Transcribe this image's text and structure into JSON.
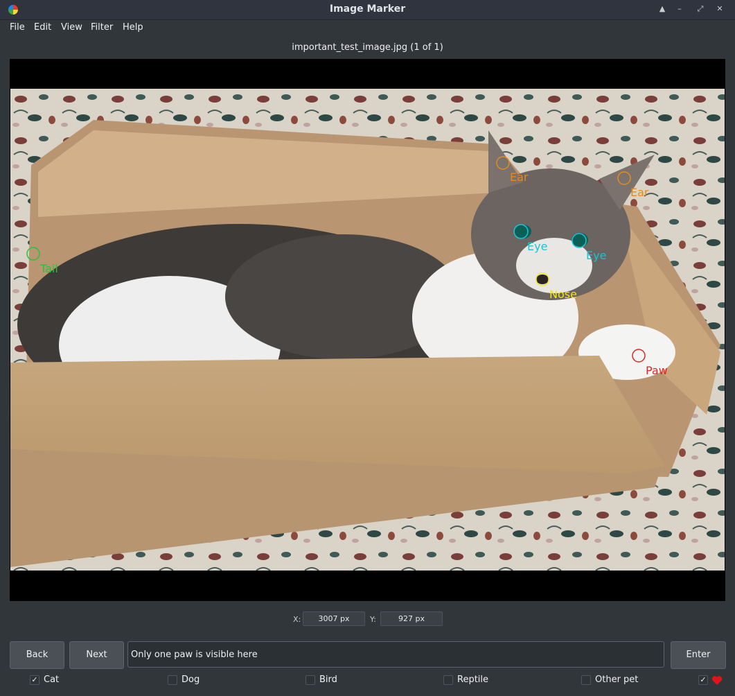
{
  "window": {
    "title": "Image Marker",
    "buttons": [
      "keep-above",
      "minimize",
      "restore",
      "close"
    ]
  },
  "menu": {
    "file": "File",
    "edit": "Edit",
    "view": "View",
    "filter": "Filter",
    "help": "Help"
  },
  "image": {
    "label": "important_test_image.jpg (1 of 1)",
    "marks": [
      {
        "label": "Ear",
        "color": "#e68a1e"
      },
      {
        "label": "Ear",
        "color": "#e68a1e"
      },
      {
        "label": "Eye",
        "color": "#17c6d4"
      },
      {
        "label": "Eye",
        "color": "#17c6d4"
      },
      {
        "label": "Nose",
        "color": "#f3e616"
      },
      {
        "label": "Tail",
        "color": "#27c33a"
      },
      {
        "label": "Paw",
        "color": "#e52424"
      }
    ]
  },
  "coords": {
    "x_label": "X:",
    "x_value": "3007 px",
    "y_label": "Y:",
    "y_value": "927 px"
  },
  "controls": {
    "back": "Back",
    "next": "Next",
    "comment": "Only one paw is visible here",
    "enter": "Enter"
  },
  "categories": [
    {
      "label": "Cat",
      "checked": true
    },
    {
      "label": "Dog",
      "checked": false
    },
    {
      "label": "Bird",
      "checked": false
    },
    {
      "label": "Reptile",
      "checked": false
    },
    {
      "label": "Other pet",
      "checked": false
    }
  ],
  "favorite": {
    "checked": true,
    "icon": "heart-icon",
    "color": "#e0141c"
  }
}
